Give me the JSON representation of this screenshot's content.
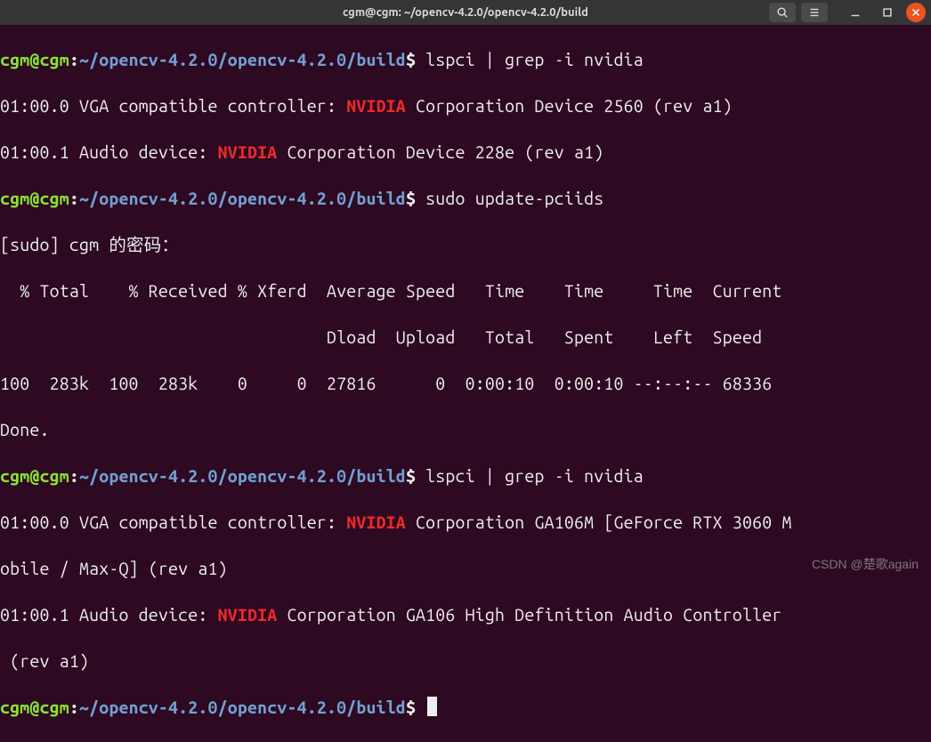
{
  "window": {
    "title": "cgm@cgm: ~/opencv-4.2.0/opencv-4.2.0/build"
  },
  "prompt": {
    "user_host": "cgm@cgm",
    "colon": ":",
    "path": "~/opencv-4.2.0/opencv-4.2.0/build",
    "sigil": "$"
  },
  "cmds": {
    "lspci1": " lspci | grep -i nvidia",
    "update": " sudo update-pciids",
    "lspci2": " lspci | grep -i nvidia"
  },
  "out": {
    "vga1_a": "01:00.0 VGA compatible controller: ",
    "nvidia": "NVIDIA",
    "vga1_b": " Corporation Device 2560 (rev a1)",
    "aud1_a": "01:00.1 Audio device: ",
    "aud1_b": " Corporation Device 228e (rev a1)",
    "sudo_prompt": "[sudo] cgm 的密码：",
    "curl_hdr1": "  % Total    % Received % Xferd  Average Speed   Time    Time     Time  Current",
    "curl_hdr2": "                                 Dload  Upload   Total   Spent    Left  Speed",
    "curl_row": "100  283k  100  283k    0     0  27816      0  0:00:10  0:00:10 --:--:-- 68336",
    "done": "Done.",
    "vga2_a": "01:00.0 VGA compatible controller: ",
    "vga2_b": " Corporation GA106M [GeForce RTX 3060 M",
    "vga2_c": "obile / Max-Q] (rev a1)",
    "aud2_a": "01:00.1 Audio device: ",
    "aud2_b": " Corporation GA106 High Definition Audio Controller",
    "aud2_c": " (rev a1)"
  },
  "watermark": "CSDN @楚歌again"
}
